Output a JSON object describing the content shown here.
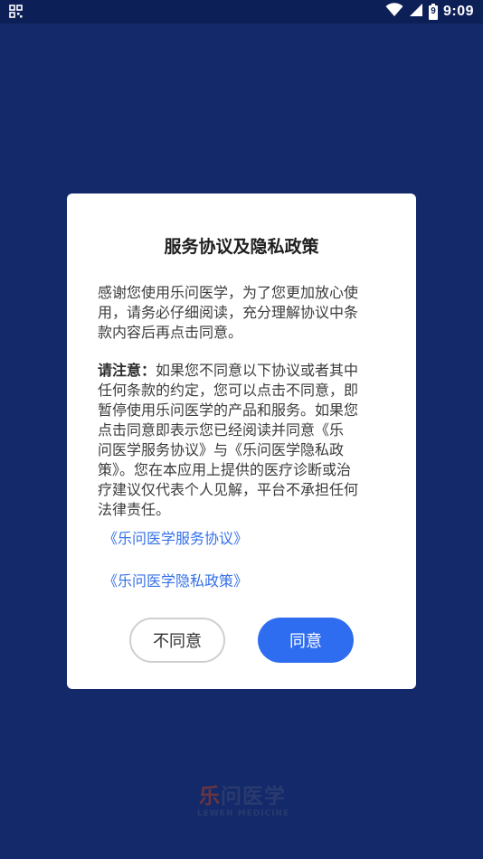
{
  "status_bar": {
    "time": "9:09",
    "battery_level": "9"
  },
  "dialog": {
    "title": "服务协议及隐私政策",
    "intro": "感谢您使用乐问医学，为了您更加放心使\n用，请务必仔细阅读，充分理解协议中条\n款内容后再点击同意。",
    "notice_label": "请注意：",
    "notice_body": "如果您不同意以下协议或者其中\n任何条款的约定，您可以点击不同意，即\n暂停使用乐问医学的产品和服务。如果您\n点击同意即表示您已经阅读并同意《乐\n问医学服务协议》与《乐问医学隐私政\n策》。您在本应用上提供的医疗诊断或治\n疗建议仅代表个人见解，平台不承担任何\n法律责任。",
    "link_service": "《乐问医学服务协议》",
    "link_privacy": "《乐问医学隐私政策》",
    "disagree_label": "不同意",
    "agree_label": "同意"
  },
  "logo": {
    "cn_first": "乐",
    "cn_rest": "问医学",
    "en": "LEWEN MEDICINE"
  },
  "colors": {
    "background": "#13296a",
    "accent": "#2f6df0",
    "link": "#3570e8"
  }
}
